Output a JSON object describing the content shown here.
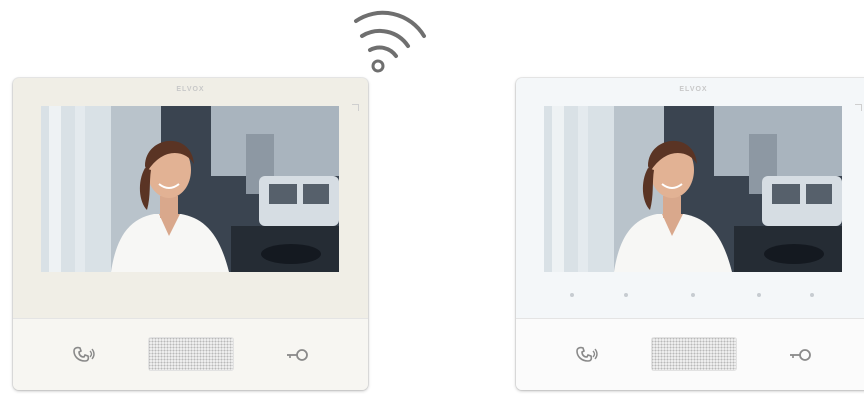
{
  "brand": "ELVOX",
  "colors": {
    "wifi": "#6f6f6f",
    "left_panel": "#f0eee6",
    "right_panel": "#f4f7f9",
    "icon": "#8a8a8a"
  },
  "devices": [
    {
      "variant": "ivory",
      "screen_content": "visitor-video",
      "buttons": [
        {
          "icon": "handset-talk-icon"
        },
        {
          "icon": "door-key-icon"
        }
      ]
    },
    {
      "variant": "white",
      "screen_content": "visitor-video",
      "touch_dot_count": 5,
      "buttons": [
        {
          "icon": "handset-talk-icon"
        },
        {
          "icon": "door-key-icon"
        }
      ]
    }
  ]
}
